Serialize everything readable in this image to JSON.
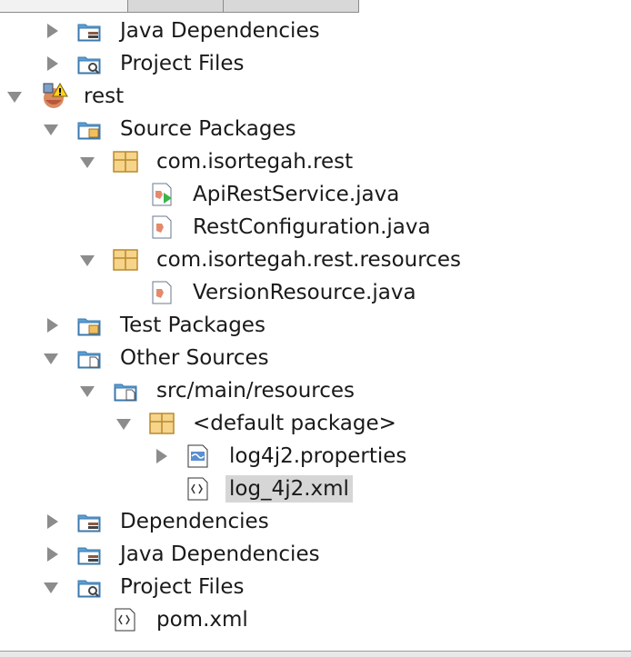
{
  "window": {
    "accent": "#d6d6d6"
  },
  "rows": [
    {
      "label": "Java Dependencies",
      "icon": "java-dependencies-folder-icon",
      "toggle": "collapsed",
      "level": 1
    },
    {
      "label": "Project Files",
      "icon": "project-files-folder-icon",
      "toggle": "collapsed",
      "level": 1
    },
    {
      "label": "rest",
      "icon": "maven-project-warning-icon",
      "toggle": "expanded",
      "level": 0
    },
    {
      "label": "Source Packages",
      "icon": "source-packages-folder-icon",
      "toggle": "expanded",
      "level": 1
    },
    {
      "label": "com.isortegah.rest",
      "icon": "package-icon",
      "toggle": "expanded",
      "level": 2
    },
    {
      "label": "ApiRestService.java",
      "icon": "java-main-class-icon",
      "toggle": "none",
      "level": 3
    },
    {
      "label": "RestConfiguration.java",
      "icon": "java-class-icon",
      "toggle": "none",
      "level": 3
    },
    {
      "label": "com.isortegah.rest.resources",
      "icon": "package-icon",
      "toggle": "expanded",
      "level": 2
    },
    {
      "label": "VersionResource.java",
      "icon": "java-class-icon",
      "toggle": "none",
      "level": 3
    },
    {
      "label": "Test Packages",
      "icon": "test-packages-folder-icon",
      "toggle": "collapsed",
      "level": 1
    },
    {
      "label": "Other Sources",
      "icon": "other-sources-folder-icon",
      "toggle": "expanded",
      "level": 1
    },
    {
      "label": "src/main/resources",
      "icon": "resources-folder-icon",
      "toggle": "expanded",
      "level": 2
    },
    {
      "label": "<default package>",
      "icon": "package-icon",
      "toggle": "expanded",
      "level": 3
    },
    {
      "label": "log4j2.properties",
      "icon": "properties-file-icon",
      "toggle": "collapsed",
      "level": 4
    },
    {
      "label": "log_4j2.xml",
      "icon": "xml-file-icon",
      "toggle": "none",
      "level": 4,
      "selected": true
    },
    {
      "label": "Dependencies",
      "icon": "dependencies-folder-icon",
      "toggle": "collapsed",
      "level": 1
    },
    {
      "label": "Java Dependencies",
      "icon": "java-dependencies-folder-icon",
      "toggle": "collapsed",
      "level": 1
    },
    {
      "label": "Project Files",
      "icon": "project-files-folder-icon",
      "toggle": "expanded",
      "level": 1
    },
    {
      "label": "pom.xml",
      "icon": "xml-file-icon",
      "toggle": "none",
      "level": 2
    }
  ]
}
